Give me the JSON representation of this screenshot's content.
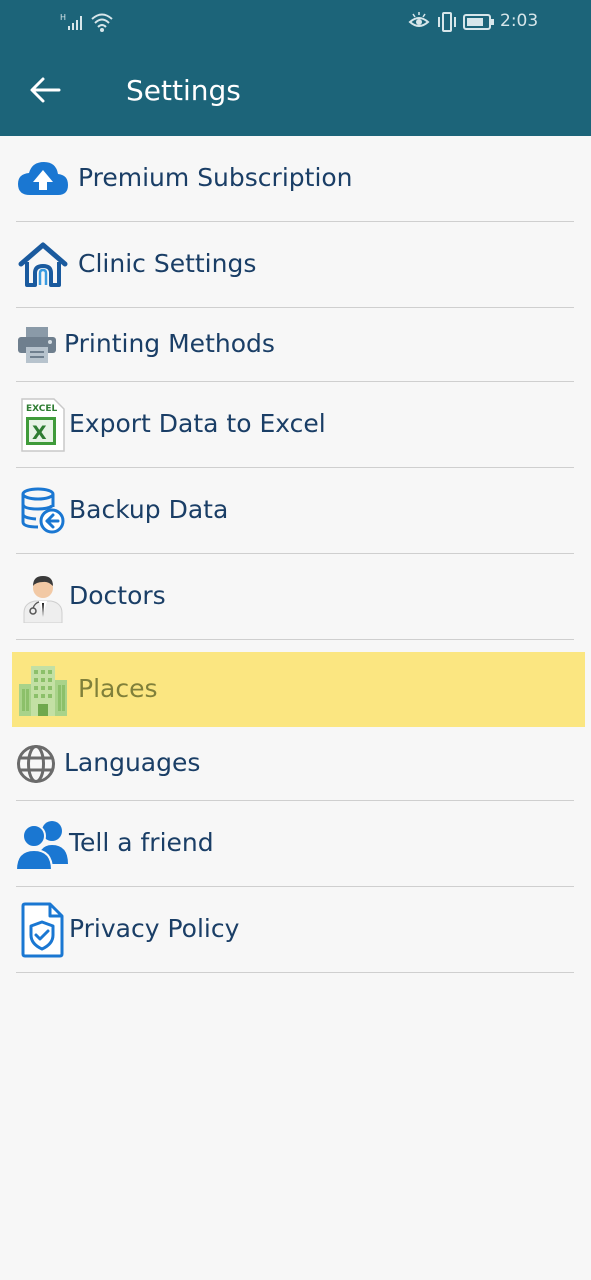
{
  "status_bar": {
    "time": "2:03",
    "icons": [
      "signal-icon",
      "wifi-icon",
      "eye-comfort-icon",
      "vibrate-icon",
      "battery-icon"
    ]
  },
  "header": {
    "title": "Settings",
    "back_icon": "arrow-left-icon"
  },
  "menu": {
    "items": [
      {
        "label": "Premium Subscription",
        "icon": "cloud-upload-icon"
      },
      {
        "label": "Clinic Settings",
        "icon": "home-icon"
      },
      {
        "label": "Printing Methods",
        "icon": "printer-icon"
      },
      {
        "label": "Export Data to Excel",
        "icon": "excel-icon"
      },
      {
        "label": "Backup Data",
        "icon": "database-backup-icon"
      },
      {
        "label": "Doctors",
        "icon": "doctor-icon"
      },
      {
        "label": "Places",
        "icon": "building-icon",
        "highlighted": true
      },
      {
        "label": "Languages",
        "icon": "globe-icon"
      },
      {
        "label": "Tell a friend",
        "icon": "users-icon"
      },
      {
        "label": "Privacy Policy",
        "icon": "shield-document-icon"
      }
    ]
  },
  "colors": {
    "header_bg": "#1c6479",
    "text": "#1a3e66",
    "highlight_bg": "#fbe681",
    "highlight_text": "#80803a",
    "divider": "#cfcfcf",
    "page_bg": "#f7f7f7"
  }
}
